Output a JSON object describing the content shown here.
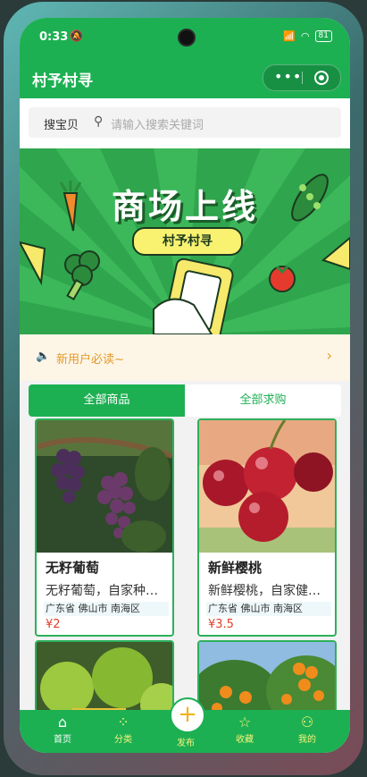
{
  "status_bar": {
    "time": "0:33",
    "battery": "81"
  },
  "nav": {
    "title": "村予村寻"
  },
  "search": {
    "label": "搜宝贝",
    "placeholder": "请输入搜索关键词"
  },
  "banner": {
    "headline": "商场上线",
    "tag": "村予村寻"
  },
  "notice": {
    "text": "新用户必读~"
  },
  "tabs": [
    {
      "label": "全部商品",
      "active": true
    },
    {
      "label": "全部求购",
      "active": false
    }
  ],
  "products": [
    {
      "name": "无籽葡萄",
      "desc": "无籽葡萄，自家种植，新鲜",
      "location": "广东省 佛山市 南海区",
      "price": "¥2"
    },
    {
      "name": "新鲜樱桃",
      "desc": "新鲜樱桃，自家健康种植",
      "location": "广东省 佛山市 南海区",
      "price": "¥3.5"
    }
  ],
  "tabbar": [
    {
      "label": "首页",
      "icon": "home-icon"
    },
    {
      "label": "分类",
      "icon": "grid-icon"
    },
    {
      "label": "发布",
      "icon": "plus-icon"
    },
    {
      "label": "收藏",
      "icon": "star-icon"
    },
    {
      "label": "我的",
      "icon": "user-icon"
    }
  ],
  "colors": {
    "brand": "#1db053",
    "price": "#e0402a",
    "notice": "#e39b2b"
  }
}
